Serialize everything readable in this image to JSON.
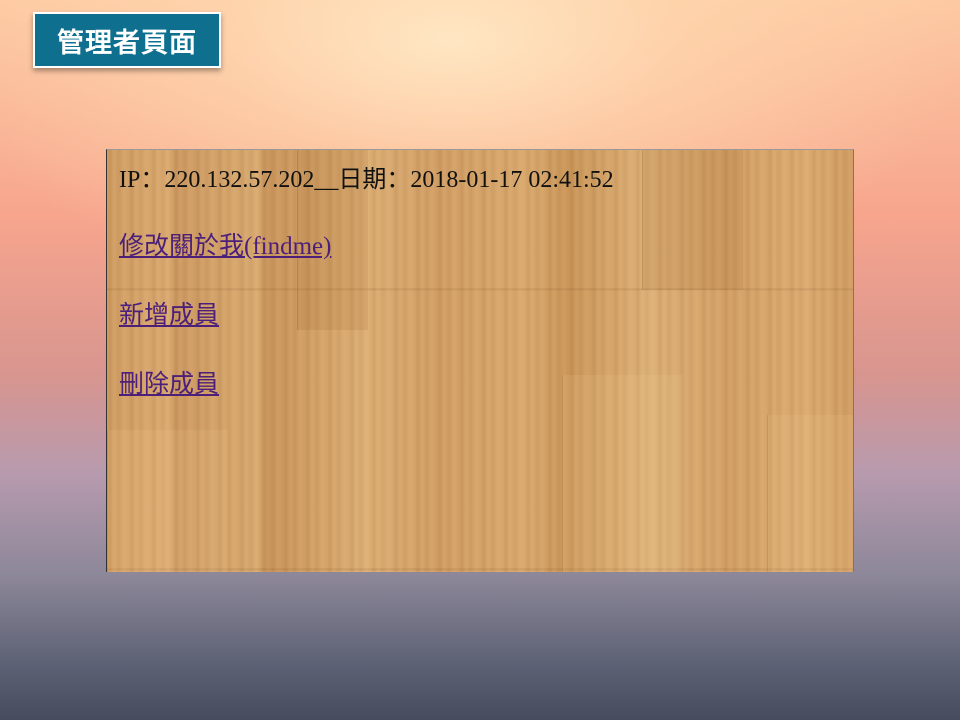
{
  "title_badge": {
    "text": "管理者頁面"
  },
  "admin_page": {
    "info": "IP：220.132.57.202__日期：2018-01-17 02:41:52",
    "links": [
      {
        "label": "修改關於我(findme)"
      },
      {
        "label": "新增成員"
      },
      {
        "label": "刪除成員"
      }
    ]
  },
  "colors": {
    "badge_background": "#0e6f8f",
    "link_visited": "#4b1f7a",
    "wood_background": "#d6a56b"
  }
}
